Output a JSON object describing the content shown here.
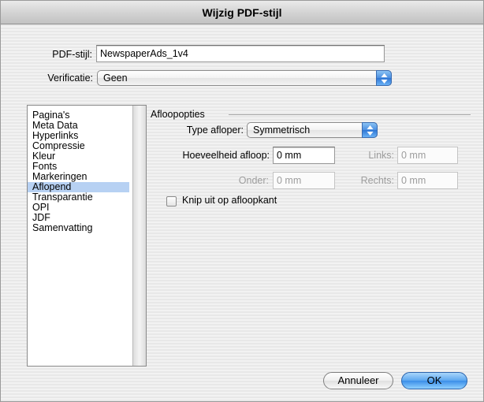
{
  "window": {
    "title": "Wijzig PDF-stijl"
  },
  "style": {
    "label": "PDF-stijl:",
    "value": "NewspaperAds_1v4"
  },
  "verification": {
    "label": "Verificatie:",
    "value": "Geen"
  },
  "sidebar": {
    "items": [
      {
        "label": "Pagina's",
        "selected": false
      },
      {
        "label": "Meta Data",
        "selected": false
      },
      {
        "label": "Hyperlinks",
        "selected": false
      },
      {
        "label": "Compressie",
        "selected": false
      },
      {
        "label": "Kleur",
        "selected": false
      },
      {
        "label": "Fonts",
        "selected": false
      },
      {
        "label": "Markeringen",
        "selected": false
      },
      {
        "label": "Aflopend",
        "selected": true
      },
      {
        "label": "Transparantie",
        "selected": false
      },
      {
        "label": "OPI",
        "selected": false
      },
      {
        "label": "JDF",
        "selected": false
      },
      {
        "label": "Samenvatting",
        "selected": false
      }
    ]
  },
  "bleed": {
    "group_title": "Afloopopties",
    "type_label": "Type afloper:",
    "type_value": "Symmetrisch",
    "amount_label": "Hoeveelheid afloop:",
    "amount_value": "0 mm",
    "left_label": "Links:",
    "left_value": "0 mm",
    "bottom_label": "Onder:",
    "bottom_value": "0 mm",
    "right_label": "Rechts:",
    "right_value": "0 mm",
    "clip_label": "Knip uit op afloopkant",
    "clip_checked": false
  },
  "buttons": {
    "cancel": "Annuleer",
    "ok": "OK"
  },
  "icons": {
    "popup_arrows": "up-down-arrows-icon",
    "checkbox": "checkbox-unchecked-icon"
  }
}
